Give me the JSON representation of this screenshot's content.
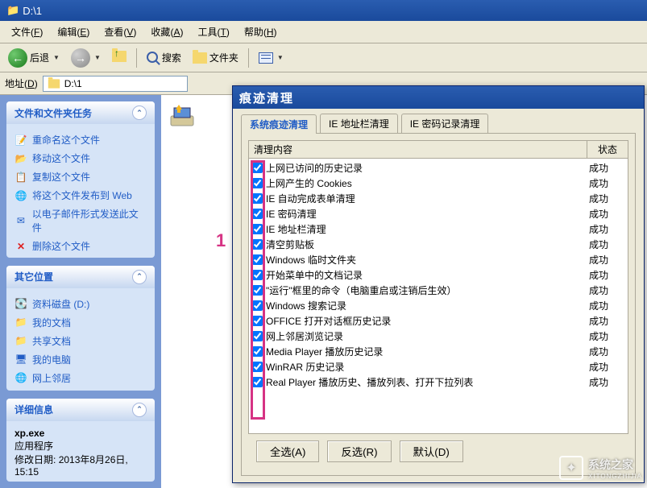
{
  "title_bar": {
    "path": "D:\\1"
  },
  "menus": [
    {
      "label": "文件",
      "key": "F"
    },
    {
      "label": "编辑",
      "key": "E"
    },
    {
      "label": "查看",
      "key": "V"
    },
    {
      "label": "收藏",
      "key": "A"
    },
    {
      "label": "工具",
      "key": "T"
    },
    {
      "label": "帮助",
      "key": "H"
    }
  ],
  "toolbar": {
    "back": "后退",
    "search": "搜索",
    "folders": "文件夹"
  },
  "address": {
    "label": "地址",
    "key": "D",
    "value": "D:\\1"
  },
  "sidebar": {
    "panel1": {
      "title": "文件和文件夹任务",
      "items": [
        "重命名这个文件",
        "移动这个文件",
        "复制这个文件",
        "将这个文件发布到 Web",
        "以电子邮件形式发送此文件",
        "删除这个文件"
      ]
    },
    "panel2": {
      "title": "其它位置",
      "items": [
        "资料磁盘 (D:)",
        "我的文档",
        "共享文档",
        "我的电脑",
        "网上邻居"
      ]
    },
    "panel3": {
      "title": "详细信息",
      "name": "xp.exe",
      "type": "应用程序",
      "date_label": "修改日期:",
      "date_value": "2013年8月26日, 15:15"
    }
  },
  "marker": "1",
  "dialog": {
    "title": "痕迹清理",
    "tabs": [
      "系统痕迹清理",
      "IE 地址栏清理",
      "IE 密码记录清理"
    ],
    "headers": {
      "col1": "清理内容",
      "col2": "状态"
    },
    "rows": [
      {
        "label": "上网已访问的历史记录",
        "status": "成功",
        "checked": true
      },
      {
        "label": "上网产生的 Cookies",
        "status": "成功",
        "checked": true
      },
      {
        "label": "IE 自动完成表单清理",
        "status": "成功",
        "checked": true
      },
      {
        "label": "IE 密码清理",
        "status": "成功",
        "checked": true
      },
      {
        "label": "IE 地址栏清理",
        "status": "成功",
        "checked": true
      },
      {
        "label": "清空剪贴板",
        "status": "成功",
        "checked": true
      },
      {
        "label": "Windows 临时文件夹",
        "status": "成功",
        "checked": true
      },
      {
        "label": "开始菜单中的文档记录",
        "status": "成功",
        "checked": true
      },
      {
        "label": "\"运行\"框里的命令（电脑重启或注销后生效）",
        "status": "成功",
        "checked": true
      },
      {
        "label": "Windows 搜索记录",
        "status": "成功",
        "checked": true
      },
      {
        "label": "OFFICE 打开对话框历史记录",
        "status": "成功",
        "checked": true
      },
      {
        "label": "网上邻居浏览记录",
        "status": "成功",
        "checked": true
      },
      {
        "label": "Media Player 播放历史记录",
        "status": "成功",
        "checked": true
      },
      {
        "label": "WinRAR 历史记录",
        "status": "成功",
        "checked": true
      },
      {
        "label": "Real Player 播放历史、播放列表、打开下拉列表",
        "status": "成功",
        "checked": true
      }
    ],
    "buttons": {
      "select_all": "全选(A)",
      "invert": "反选(R)",
      "default": "默认(D)"
    }
  },
  "watermark": {
    "text": "系统之家",
    "sub": "XITONGZHIJIA"
  }
}
